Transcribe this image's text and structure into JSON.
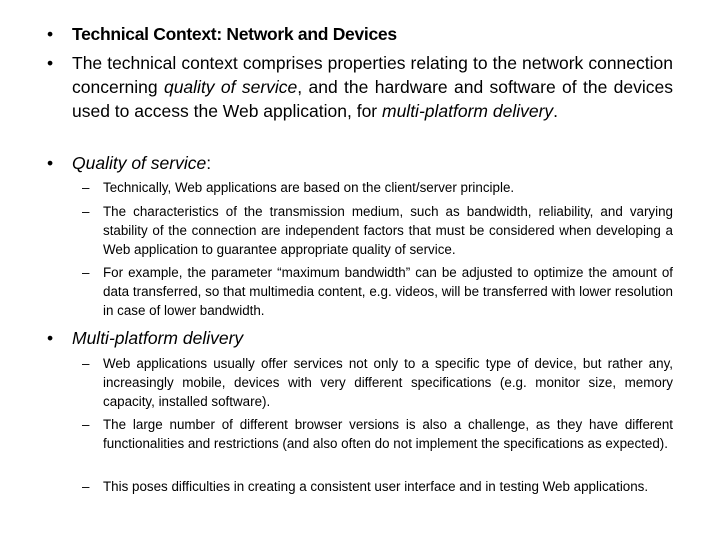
{
  "bullets": {
    "glyph": "•",
    "dash": "–"
  },
  "items": [
    {
      "title": "Technical Context: Network and Devices"
    },
    {
      "parts": [
        "The technical context comprises properties relating to the network connection concerning ",
        "quality of service",
        ", and the hardware and software of the devices used to access the Web application, for ",
        "multi-platform delivery",
        "."
      ]
    },
    {
      "heading": "Quality of service",
      "heading_suffix": ":",
      "subitems": [
        "Technically, Web applications are based on the client/server principle.",
        "The characteristics of the transmission medium, such as bandwidth, reliability, and varying stability of the connection are independent factors that must be considered when developing a Web application to guarantee appropriate quality of service.",
        "For example, the parameter “maximum bandwidth” can be adjusted to optimize the amount of data transferred, so that multimedia content, e.g. videos, will be transferred with lower resolution in case of lower bandwidth."
      ]
    },
    {
      "heading": "Multi-platform delivery",
      "subitems": [
        "Web applications usually offer services not only to a specific type of device, but rather any, increasingly mobile, devices with very different specifications (e.g. monitor size, memory capacity, installed software).",
        "The large number of different browser versions is also a challenge, as they have different functionalities and restrictions (and also often do not implement the specifications as expected).",
        "This poses difficulties in creating a consistent user interface and in testing Web applications."
      ]
    }
  ]
}
